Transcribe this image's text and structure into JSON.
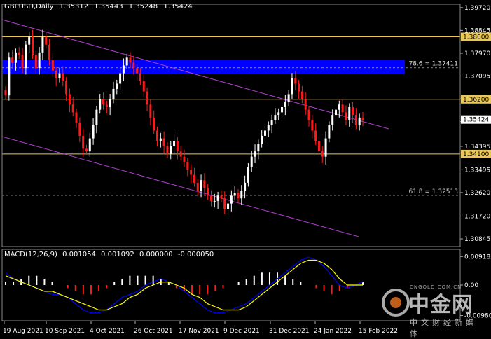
{
  "header": {
    "symbol": "GBPUSD,Daily",
    "open": "1.35312",
    "high": "1.35443",
    "low": "1.35248",
    "close": "1.35424"
  },
  "macd": {
    "label": "MACD(12,26,9)",
    "v1": "0.001054",
    "v2": "0.001092",
    "v3": "0.000000",
    "v4": "-0.000050",
    "axis_ticks": [
      "0.009182",
      "0.00",
      "-0.009806"
    ]
  },
  "watermark": {
    "brand": "中金网",
    "url": "CNGOLD.COM.CN",
    "sub": "中文财经新媒体"
  },
  "colors": {
    "background": "#000000",
    "bull": "#ffffff",
    "bear": "#ff1a1a",
    "channel": "#b040d0",
    "level": "#e8c85a",
    "zone": "#0000ff",
    "macd_line": "#0000ff",
    "signal_line": "#ffff00",
    "hist_pos": "#ffffff",
    "hist_neg": "#ff1a1a"
  },
  "chart_data": {
    "type": "candlestick",
    "x_ticks": [
      "19 Aug 2021",
      "10 Sep 2021",
      "4 Oct 2021",
      "26 Oct 2021",
      "17 Nov 2021",
      "9 Dec 2021",
      "31 Dec 2021",
      "24 Jan 2022",
      "15 Feb 2022"
    ],
    "y_ticks": [
      "1.39720",
      "1.38845",
      "1.37970",
      "1.37095",
      "1.36220",
      "1.35345",
      "1.34395",
      "1.33495",
      "1.32620",
      "1.31720",
      "1.30845"
    ],
    "ylim": [
      1.3055,
      1.3985
    ],
    "levels": [
      {
        "value": 1.386,
        "label": "1.38600"
      },
      {
        "value": 1.362,
        "label": "1.36200"
      },
      {
        "value": 1.341,
        "label": "1.34100"
      }
    ],
    "current": {
      "value": 1.35424,
      "label": "1.35424"
    },
    "fib_levels": [
      {
        "value": 1.37411,
        "label": "78.6 = 1.37411"
      },
      {
        "value": 1.32513,
        "label": "61.8 = 1.32513"
      }
    ],
    "zone": {
      "from": 1.3718,
      "to": 1.3772
    },
    "closes": [
      1.3635,
      1.378,
      1.376,
      1.38,
      1.379,
      1.374,
      1.383,
      1.386,
      1.379,
      1.374,
      1.38,
      1.386,
      1.383,
      1.377,
      1.373,
      1.37,
      1.372,
      1.369,
      1.364,
      1.36,
      1.357,
      1.353,
      1.348,
      1.343,
      1.342,
      1.347,
      1.352,
      1.358,
      1.362,
      1.36,
      1.359,
      1.362,
      1.366,
      1.368,
      1.372,
      1.375,
      1.378,
      1.376,
      1.374,
      1.372,
      1.369,
      1.365,
      1.36,
      1.355,
      1.35,
      1.346,
      1.347,
      1.344,
      1.341,
      1.344,
      1.346,
      1.342,
      1.34,
      1.338,
      1.335,
      1.333,
      1.33,
      1.327,
      1.331,
      1.328,
      1.325,
      1.323,
      1.323,
      1.325,
      1.324,
      1.32,
      1.322,
      1.325,
      1.326,
      1.324,
      1.327,
      1.33,
      1.336,
      1.34,
      1.342,
      1.345,
      1.348,
      1.35,
      1.352,
      1.354,
      1.356,
      1.357,
      1.359,
      1.361,
      1.364,
      1.37,
      1.368,
      1.365,
      1.362,
      1.358,
      1.354,
      1.35,
      1.346,
      1.342,
      1.34,
      1.347,
      1.352,
      1.356,
      1.358,
      1.36,
      1.357,
      1.354,
      1.359,
      1.356,
      1.352,
      1.355,
      1.3542
    ],
    "macd_line": [
      0.004,
      0.002,
      0.001,
      0.0,
      -0.001,
      -0.002,
      -0.003,
      -0.003,
      -0.004,
      -0.006,
      -0.008,
      -0.009,
      -0.009,
      -0.008,
      -0.006,
      -0.004,
      -0.003,
      -0.002,
      0.0,
      0.001,
      0.002,
      0.001,
      0.0,
      -0.002,
      -0.004,
      -0.006,
      -0.008,
      -0.009,
      -0.009,
      -0.008,
      -0.007,
      -0.006,
      -0.004,
      -0.002,
      0.0,
      0.002,
      0.004,
      0.006,
      0.008,
      0.009,
      0.008,
      0.006,
      0.003,
      0.0,
      -0.001,
      0.0,
      0.001
    ],
    "signal_line": [
      0.003,
      0.002,
      0.001,
      0.0,
      -0.001,
      -0.002,
      -0.002,
      -0.003,
      -0.004,
      -0.005,
      -0.006,
      -0.007,
      -0.008,
      -0.008,
      -0.007,
      -0.006,
      -0.004,
      -0.003,
      -0.001,
      0.0,
      0.001,
      0.001,
      0.0,
      -0.001,
      -0.003,
      -0.004,
      -0.006,
      -0.007,
      -0.008,
      -0.008,
      -0.008,
      -0.007,
      -0.005,
      -0.003,
      -0.001,
      0.001,
      0.003,
      0.005,
      0.007,
      0.008,
      0.008,
      0.007,
      0.005,
      0.002,
      0.0,
      0.0,
      0.0
    ],
    "histogram": [
      0.001,
      0.001,
      0.002,
      0.003,
      0.003,
      0.002,
      0.001,
      0.0,
      -0.001,
      -0.002,
      -0.003,
      -0.003,
      -0.002,
      -0.001,
      0.001,
      0.002,
      0.003,
      0.003,
      0.003,
      0.003,
      0.002,
      0.001,
      -0.001,
      -0.002,
      -0.003,
      -0.003,
      -0.003,
      -0.002,
      -0.001,
      0.0,
      0.001,
      0.002,
      0.003,
      0.004,
      0.004,
      0.004,
      0.003,
      0.002,
      0.001,
      0.0,
      -0.001,
      -0.002,
      -0.003,
      -0.002,
      -0.001,
      0.0,
      0.001
    ]
  }
}
